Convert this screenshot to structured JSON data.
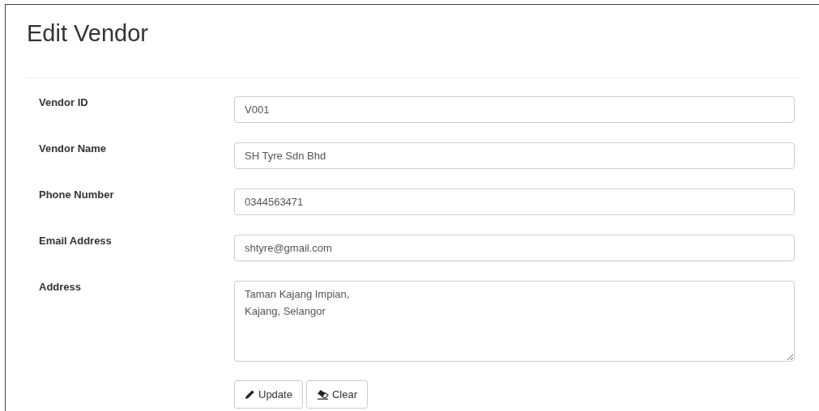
{
  "title": "Edit Vendor",
  "fields": [
    {
      "label": "Vendor ID",
      "kind": "input",
      "value": "V001"
    },
    {
      "label": "Vendor Name",
      "kind": "input",
      "value": "SH Tyre Sdn Bhd"
    },
    {
      "label": "Phone Number",
      "kind": "input",
      "value": "0344563471"
    },
    {
      "label": "Email Address",
      "kind": "input",
      "value": "shtyre@gmail.com"
    },
    {
      "label": "Address",
      "kind": "textarea",
      "value": "Taman Kajang Impian,\nKajang, Selangor"
    }
  ],
  "buttons": [
    {
      "label": "Update",
      "kind": "pencil"
    },
    {
      "label": "Clear",
      "kind": "eraser"
    }
  ]
}
